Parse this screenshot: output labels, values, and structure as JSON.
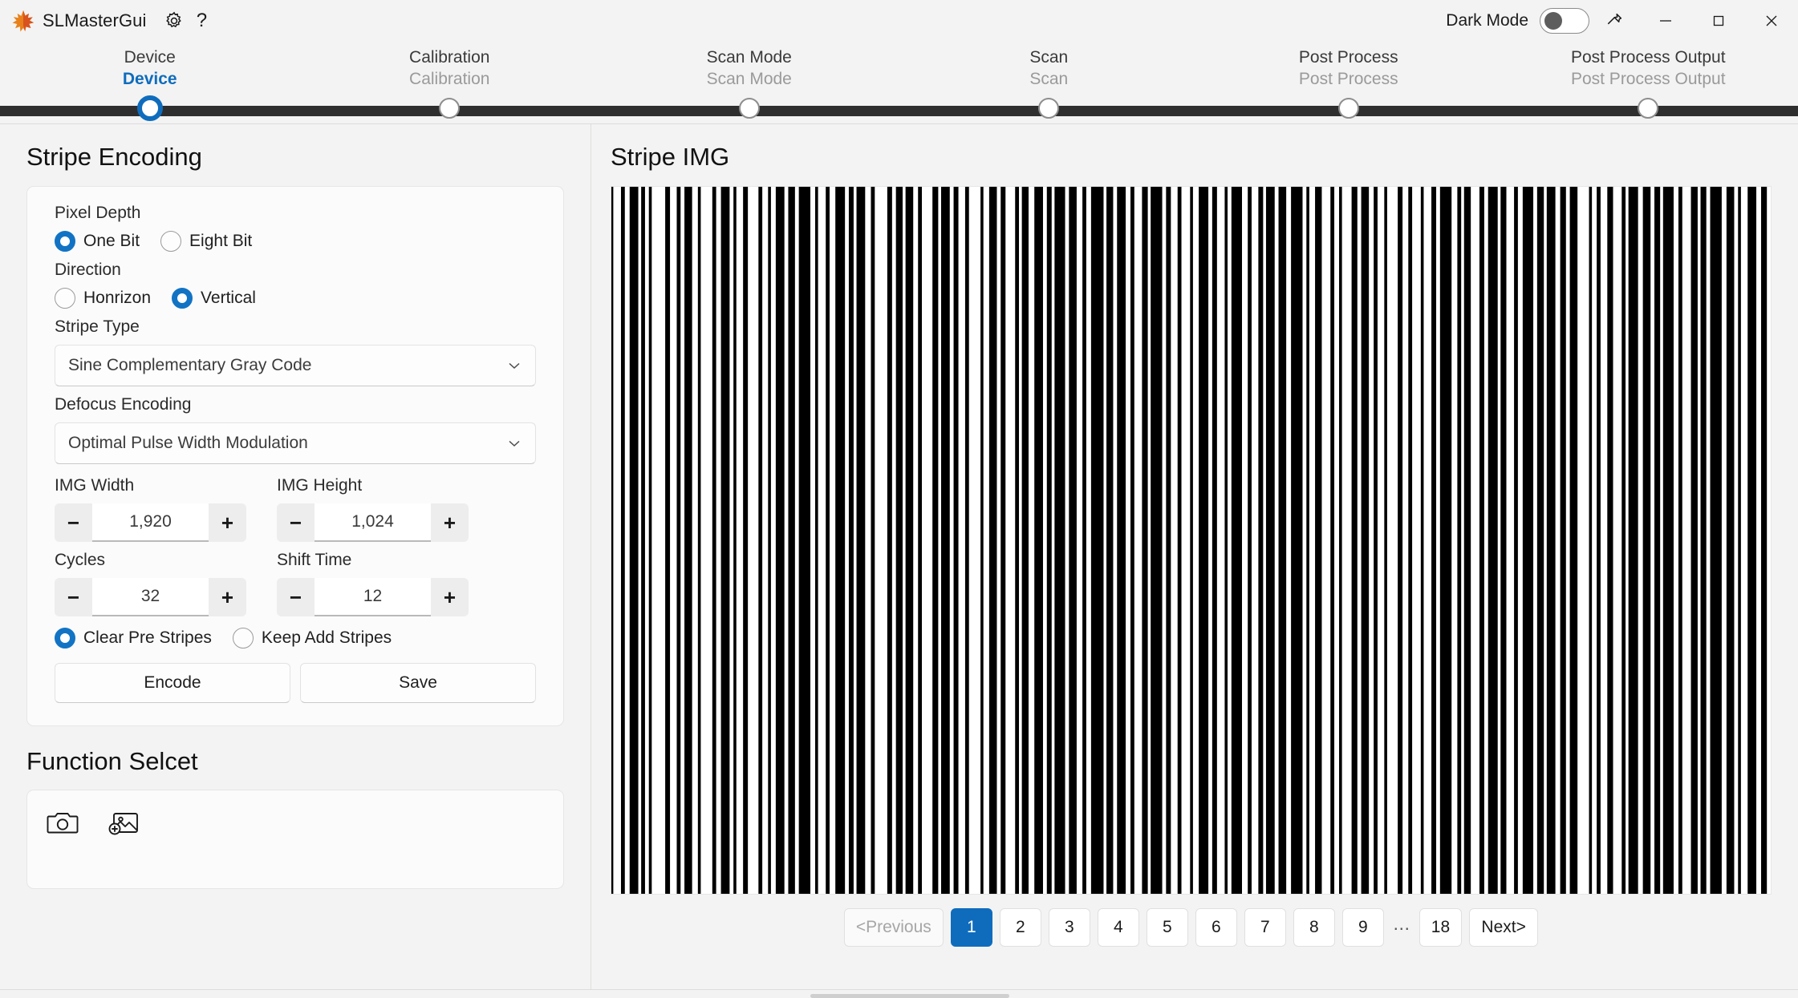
{
  "titlebar": {
    "app_name": "SLMasterGui",
    "logo_icon": "maple-leaf-icon",
    "settings_icon": "gear-icon",
    "help_icon": "question-mark-icon",
    "dark_mode_label": "Dark Mode",
    "dark_mode_on": false,
    "pin_icon": "pin-icon",
    "minimize_icon": "minimize-icon",
    "maximize_icon": "maximize-icon",
    "close_icon": "close-icon"
  },
  "stepper": {
    "active_index": 0,
    "steps": [
      {
        "top": "Device",
        "bottom": "Device"
      },
      {
        "top": "Calibration",
        "bottom": "Calibration"
      },
      {
        "top": "Scan Mode",
        "bottom": "Scan Mode"
      },
      {
        "top": "Scan",
        "bottom": "Scan"
      },
      {
        "top": "Post Process",
        "bottom": "Post Process"
      },
      {
        "top": "Post Process Output",
        "bottom": "Post Process Output"
      }
    ]
  },
  "left": {
    "section_title": "Stripe Encoding",
    "pixel_depth_label": "Pixel Depth",
    "pixel_depth_options": [
      {
        "label": "One Bit",
        "selected": true
      },
      {
        "label": "Eight Bit",
        "selected": false
      }
    ],
    "direction_label": "Direction",
    "direction_options": [
      {
        "label": "Honrizon",
        "selected": false
      },
      {
        "label": "Vertical",
        "selected": true
      }
    ],
    "stripe_type_label": "Stripe Type",
    "stripe_type_value": "Sine Complementary Gray Code",
    "defocus_label": "Defocus Encoding",
    "defocus_value": "Optimal Pulse Width Modulation",
    "img_width_label": "IMG Width",
    "img_width_value": "1,920",
    "img_height_label": "IMG Height",
    "img_height_value": "1,024",
    "cycles_label": "Cycles",
    "cycles_value": "32",
    "shift_time_label": "Shift Time",
    "shift_time_value": "12",
    "stripe_mode_options": [
      {
        "label": "Clear Pre Stripes",
        "selected": true
      },
      {
        "label": "Keep Add Stripes",
        "selected": false
      }
    ],
    "encode_button": "Encode",
    "save_button": "Save",
    "minus_symbol": "−",
    "plus_symbol": "+",
    "function_select_title": "Function Selcet",
    "function_icons": [
      {
        "name": "camera-icon"
      },
      {
        "name": "add-image-icon"
      }
    ]
  },
  "right": {
    "section_title": "Stripe IMG",
    "stripe_image": {
      "background": "#ffffff",
      "stripe_color": "#000000",
      "pattern": [
        2,
        8,
        4,
        5,
        9,
        3,
        4,
        4,
        3,
        14,
        5,
        7,
        4,
        4,
        8,
        6,
        3,
        12,
        4,
        5,
        9,
        4,
        3,
        7,
        5,
        11,
        4,
        6,
        3,
        5,
        9,
        4,
        7,
        4,
        12,
        5,
        3,
        8,
        4,
        6,
        10,
        4,
        5,
        3,
        9,
        6,
        4,
        13,
        5,
        4,
        7,
        3,
        8,
        5,
        4,
        11,
        6,
        3,
        9,
        4,
        5,
        7,
        4,
        12,
        3,
        6,
        8,
        4,
        5,
        10,
        4,
        3,
        7,
        6,
        9,
        4,
        5,
        3,
        11,
        4,
        8,
        6,
        4,
        5,
        13,
        3,
        7,
        4,
        9,
        5,
        4,
        8,
        6,
        3,
        12,
        4,
        5,
        7,
        4,
        9,
        3,
        6,
        10,
        4,
        5,
        8,
        3,
        4,
        11,
        6,
        4,
        7,
        5,
        3,
        9,
        4,
        8,
        5,
        12,
        4,
        3,
        6,
        7,
        9,
        4,
        5,
        3,
        10,
        6,
        4,
        8,
        5,
        4,
        7,
        3,
        11,
        5,
        6,
        4,
        9,
        3,
        8,
        5,
        4,
        12,
        6,
        4,
        3,
        7,
        9,
        5,
        4,
        10,
        3,
        6,
        8,
        4,
        5,
        11,
        4,
        7,
        3,
        9,
        5,
        6,
        4,
        8,
        12,
        3,
        5,
        4,
        7,
        6,
        9,
        4,
        3,
        10,
        5,
        8,
        4,
        6,
        3,
        11,
        5,
        4,
        9,
        7,
        3,
        6,
        4,
        12,
        5,
        8,
        4,
        3,
        7,
        9,
        5,
        6,
        4
      ]
    },
    "pagination": {
      "previous_label": "<Previous",
      "previous_disabled": true,
      "next_label": "Next>",
      "ellipsis": "⋯",
      "pages": [
        {
          "label": "1",
          "active": true
        },
        {
          "label": "2",
          "active": false
        },
        {
          "label": "3",
          "active": false
        },
        {
          "label": "4",
          "active": false
        },
        {
          "label": "5",
          "active": false
        },
        {
          "label": "6",
          "active": false
        },
        {
          "label": "7",
          "active": false
        },
        {
          "label": "8",
          "active": false
        },
        {
          "label": "9",
          "active": false
        }
      ],
      "last_page": "18"
    }
  },
  "colors": {
    "accent": "#0f6cbd",
    "radio_accent": "#1273c4",
    "rail": "#2e2e2e",
    "window_bg": "#f3f3f3"
  }
}
